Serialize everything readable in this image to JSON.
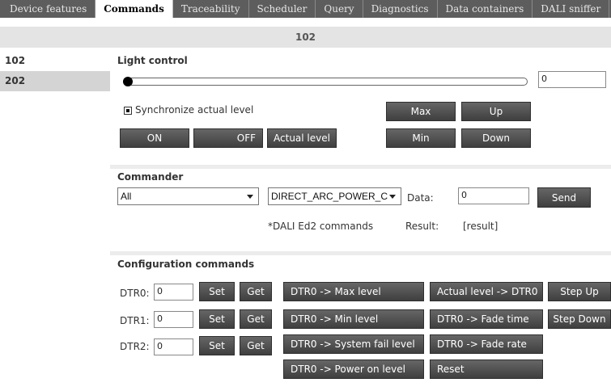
{
  "tabs": [
    {
      "label": "Device features"
    },
    {
      "label": "Commands"
    },
    {
      "label": "Traceability"
    },
    {
      "label": "Scheduler"
    },
    {
      "label": "Query"
    },
    {
      "label": "Diagnostics"
    },
    {
      "label": "Data containers"
    },
    {
      "label": "DALI sniffer"
    }
  ],
  "active_tab": "Commands",
  "device_header": "102",
  "devices": [
    "102",
    "202"
  ],
  "light_control": {
    "title": "Light control",
    "level_value": "0",
    "sync_label": "Synchronize actual level",
    "sync_checked": true,
    "buttons": {
      "max": "Max",
      "up": "Up",
      "on": "ON",
      "off": "OFF",
      "actual_level": "Actual level",
      "min": "Min",
      "down": "Down"
    }
  },
  "commander": {
    "title": "Commander",
    "address_select": "All",
    "command_select": "DIRECT_ARC_POWER_C",
    "data_label": "Data:",
    "data_value": "0",
    "send_label": "Send",
    "note": "*DALI Ed2 commands",
    "result_label": "Result:",
    "result_value": "[result]"
  },
  "configuration": {
    "title": "Configuration commands",
    "dtr_rows": [
      {
        "label": "DTR0:",
        "value": "0",
        "set": "Set",
        "get": "Get"
      },
      {
        "label": "DTR1:",
        "value": "0",
        "set": "Set",
        "get": "Get"
      },
      {
        "label": "DTR2:",
        "value": "0",
        "set": "Set",
        "get": "Get"
      }
    ],
    "col1": [
      "DTR0 -> Max level",
      "DTR0 -> Min level",
      "DTR0 -> System fail level",
      "DTR0 -> Power on level"
    ],
    "col2": [
      "Actual level -> DTR0",
      "DTR0 -> Fade time",
      "DTR0 -> Fade rate",
      "Reset"
    ],
    "col3": [
      "Step Up",
      "Step Down"
    ]
  }
}
